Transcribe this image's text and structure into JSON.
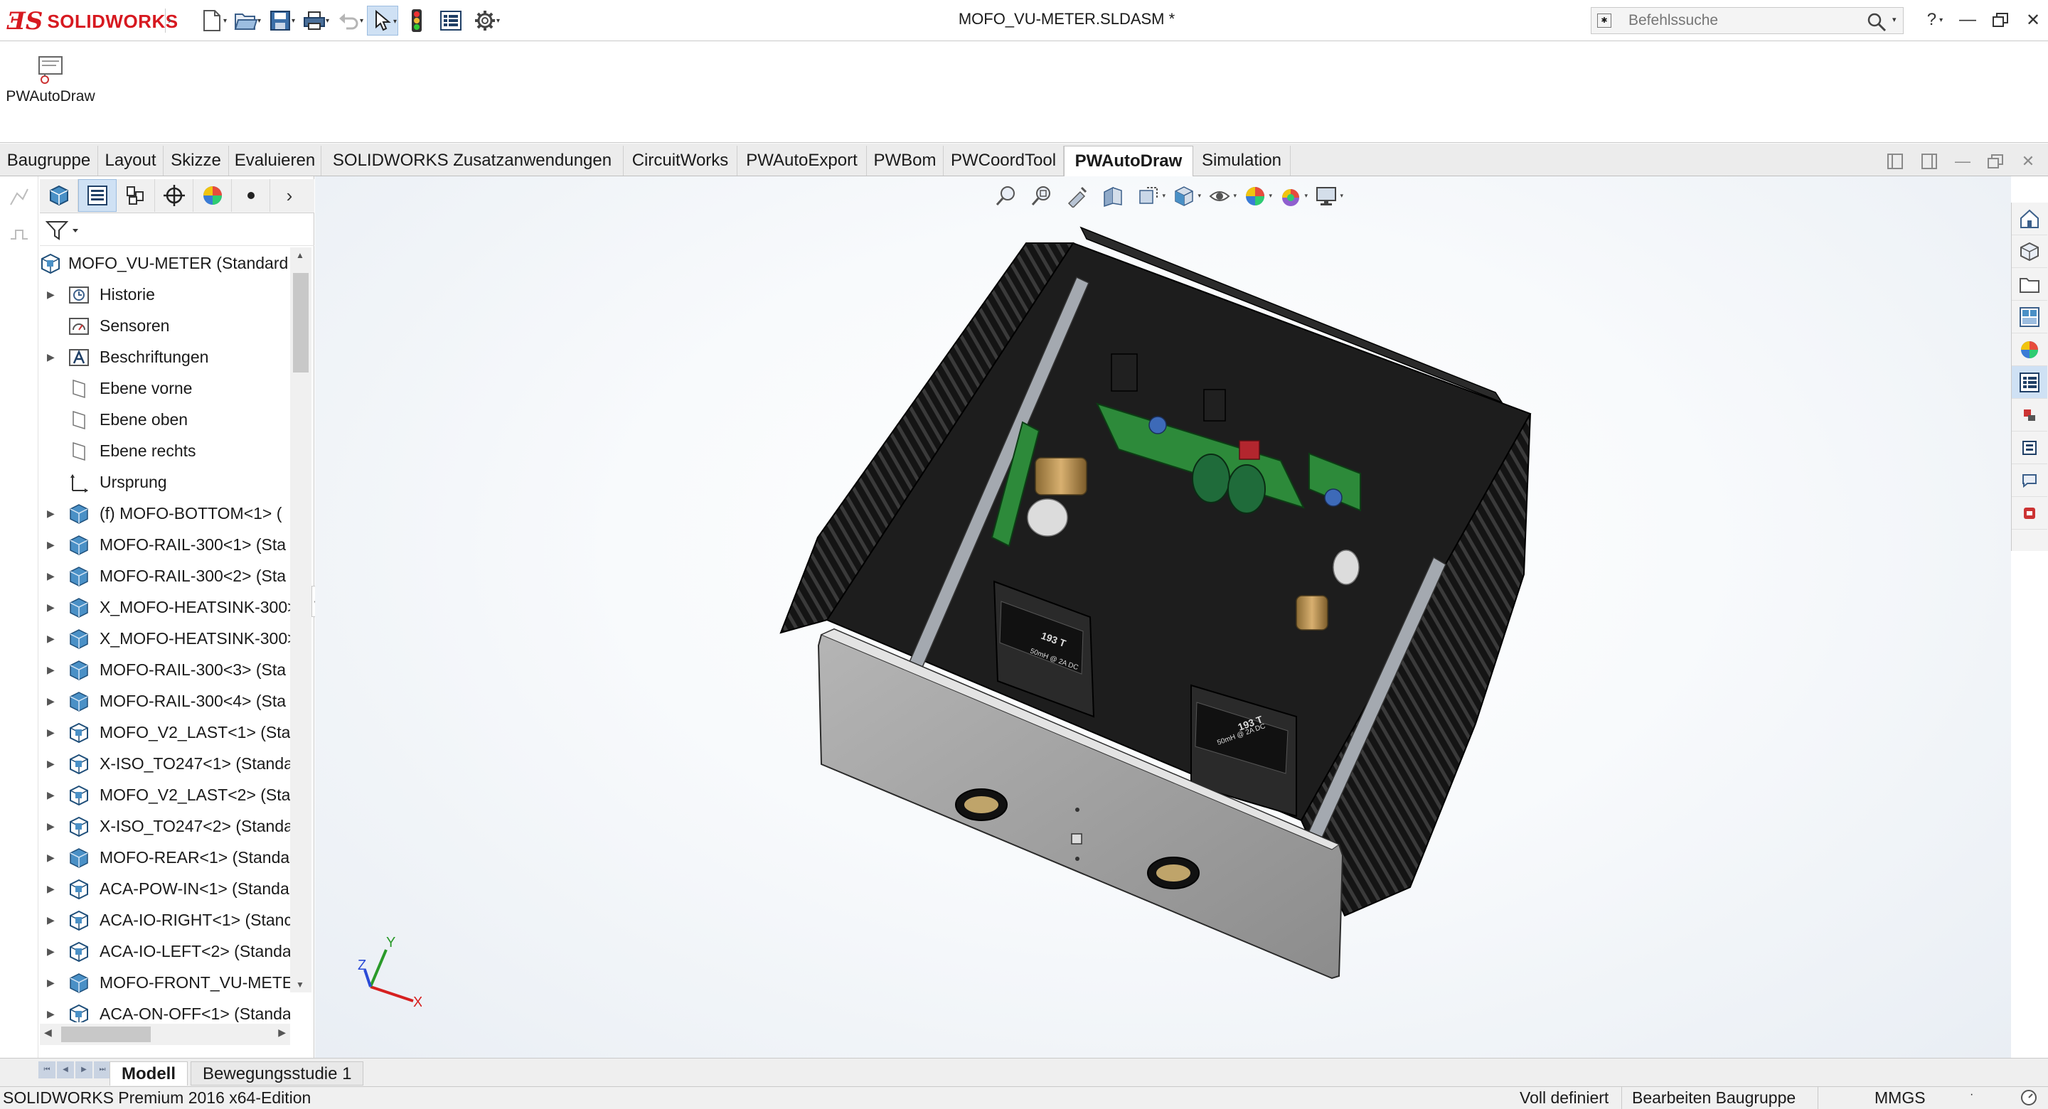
{
  "window": {
    "app_name": "SOLIDWORKS",
    "document_title": "MOFO_VU-METER.SLDASM *",
    "search_placeholder": "Befehlssuche",
    "help_label": "?"
  },
  "ribbon": {
    "buttons": [
      {
        "label": "PWAutoDraw",
        "icon": "pwautodraw-icon"
      }
    ]
  },
  "tabs": [
    {
      "label": "Baugruppe"
    },
    {
      "label": "Layout"
    },
    {
      "label": "Skizze"
    },
    {
      "label": "Evaluieren"
    },
    {
      "label": "SOLIDWORKS Zusatzanwendungen"
    },
    {
      "label": "CircuitWorks"
    },
    {
      "label": "PWAutoExport"
    },
    {
      "label": "PWBom"
    },
    {
      "label": "PWCoordTool"
    },
    {
      "label": "PWAutoDraw",
      "active": true
    },
    {
      "label": "Simulation"
    }
  ],
  "feature_tree": {
    "root": "MOFO_VU-METER  (Standard",
    "items": [
      {
        "label": "Historie",
        "icon": "history-icon",
        "expandable": true
      },
      {
        "label": "Sensoren",
        "icon": "sensor-icon",
        "expandable": false
      },
      {
        "label": "Beschriftungen",
        "icon": "annotations-icon",
        "expandable": true
      },
      {
        "label": "Ebene vorne",
        "icon": "plane-icon",
        "expandable": false
      },
      {
        "label": "Ebene oben",
        "icon": "plane-icon",
        "expandable": false
      },
      {
        "label": "Ebene rechts",
        "icon": "plane-icon",
        "expandable": false
      },
      {
        "label": "Ursprung",
        "icon": "origin-icon",
        "expandable": false
      },
      {
        "label": "(f) MOFO-BOTTOM<1> (",
        "icon": "subassembly-icon",
        "expandable": true
      },
      {
        "label": "MOFO-RAIL-300<1> (Sta",
        "icon": "subassembly-icon",
        "expandable": true
      },
      {
        "label": "MOFO-RAIL-300<2> (Sta",
        "icon": "subassembly-icon",
        "expandable": true
      },
      {
        "label": "X_MOFO-HEATSINK-300>",
        "icon": "subassembly-icon",
        "expandable": true
      },
      {
        "label": "X_MOFO-HEATSINK-300>",
        "icon": "subassembly-icon",
        "expandable": true
      },
      {
        "label": "MOFO-RAIL-300<3> (Sta",
        "icon": "subassembly-icon",
        "expandable": true
      },
      {
        "label": "MOFO-RAIL-300<4> (Sta",
        "icon": "subassembly-icon",
        "expandable": true
      },
      {
        "label": "MOFO_V2_LAST<1> (Star",
        "icon": "assembly-icon",
        "expandable": true
      },
      {
        "label": "X-ISO_TO247<1> (Standa",
        "icon": "assembly-icon",
        "expandable": true
      },
      {
        "label": "MOFO_V2_LAST<2> (Star",
        "icon": "assembly-icon",
        "expandable": true
      },
      {
        "label": "X-ISO_TO247<2> (Standa",
        "icon": "assembly-icon",
        "expandable": true
      },
      {
        "label": "MOFO-REAR<1> (Standa",
        "icon": "subassembly-icon",
        "expandable": true
      },
      {
        "label": "ACA-POW-IN<1> (Standa",
        "icon": "assembly-icon",
        "expandable": true
      },
      {
        "label": "ACA-IO-RIGHT<1> (Stanc",
        "icon": "assembly-icon",
        "expandable": true
      },
      {
        "label": "ACA-IO-LEFT<2> (Standa",
        "icon": "assembly-icon",
        "expandable": true
      },
      {
        "label": "MOFO-FRONT_VU-METEI",
        "icon": "subassembly-icon",
        "expandable": true
      },
      {
        "label": "ACA-ON-OFF<1> (Standa",
        "icon": "assembly-icon",
        "expandable": true
      }
    ]
  },
  "bottom_tabs": [
    {
      "label": "Modell",
      "active": true
    },
    {
      "label": "Bewegungsstudie 1",
      "active": false
    }
  ],
  "statusbar": {
    "product": "SOLIDWORKS Premium 2016 x64-Edition",
    "definition": "Voll definiert",
    "mode": "Bearbeiten Baugruppe",
    "units": "MMGS"
  },
  "model_labels": {
    "transformer_left": "193 T",
    "transformer_left_sub": "50mH @ 2A DC",
    "transformer_right": "193 T",
    "transformer_right_sub": "50mH @ 2A DC"
  },
  "triad": {
    "x": "X",
    "y": "Y",
    "z": "Z"
  },
  "colors": {
    "brand": "#d71920",
    "selection": "#cfe1f4",
    "part_blue": "#4a90c6",
    "pcb_green": "#2d8a3a",
    "heatsink": "#1c1c1c",
    "front_panel": "#9a9a9a"
  }
}
